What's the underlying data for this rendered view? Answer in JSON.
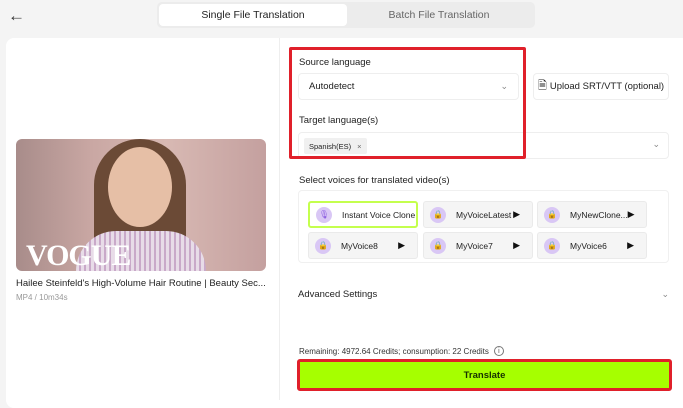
{
  "header": {
    "back_icon": "arrow-left-icon",
    "tabs": [
      {
        "label": "Single File Translation",
        "active": true
      },
      {
        "label": "Batch File Translation",
        "active": false
      }
    ]
  },
  "video": {
    "thumbnail_logo": "VOGUE",
    "title": "Hailee Steinfeld's High-Volume Hair Routine | Beauty Sec...",
    "meta": "MP4 / 10m34s"
  },
  "source": {
    "label": "Source language",
    "value": "Autodetect"
  },
  "upload": {
    "label": "Upload SRT/VTT (optional)",
    "icon": "subtitle-file-upload-icon"
  },
  "target": {
    "label": "Target language(s)",
    "chips": [
      "Spanish(ES)"
    ],
    "chip_remove": "×"
  },
  "voices": {
    "label": "Select voices for translated video(s)",
    "items": [
      {
        "name": "Instant Voice Clone",
        "icon": "microphone-icon",
        "selected": true,
        "play": false
      },
      {
        "name": "MyVoiceLatest",
        "icon": "lock-icon",
        "selected": false,
        "play": true
      },
      {
        "name": "MyNewClone...",
        "icon": "lock-icon",
        "selected": false,
        "play": true
      },
      {
        "name": "MyVoice8",
        "icon": "lock-icon",
        "selected": false,
        "play": true
      },
      {
        "name": "MyVoice7",
        "icon": "lock-icon",
        "selected": false,
        "play": true
      },
      {
        "name": "MyVoice6",
        "icon": "lock-icon",
        "selected": false,
        "play": true
      }
    ]
  },
  "advanced": {
    "label": "Advanced Settings"
  },
  "credits": {
    "text": "Remaining: 4972.64 Credits; consumption: 22 Credits"
  },
  "translate": {
    "label": "Translate"
  },
  "colors": {
    "accent": "#a6ff00",
    "highlight": "#e0202a"
  }
}
